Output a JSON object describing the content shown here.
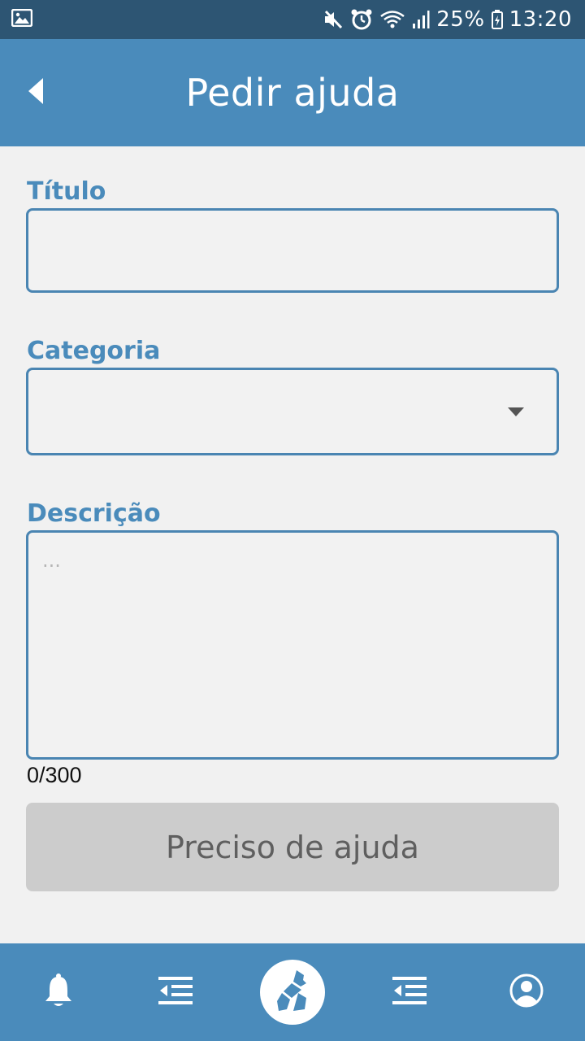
{
  "status_bar": {
    "battery": "25%",
    "time": "13:20",
    "icons": [
      "image-icon",
      "mute-icon",
      "alarm-icon",
      "wifi-icon",
      "signal-icon",
      "battery-icon"
    ]
  },
  "app_bar": {
    "title": "Pedir ajuda",
    "back_icon": "back-arrow-icon"
  },
  "form": {
    "titulo": {
      "label": "Título",
      "value": ""
    },
    "categoria": {
      "label": "Categoria",
      "selected": ""
    },
    "descricao": {
      "label": "Descrição",
      "placeholder": "...",
      "value": ""
    },
    "char_counter": "0/300",
    "submit_label": "Preciso de ajuda"
  },
  "bottom_nav": {
    "items": [
      "bell-icon",
      "list-icon",
      "help-hand-icon",
      "list-icon",
      "profile-icon"
    ]
  },
  "colors": {
    "primary": "#4a8bbb",
    "status_bar": "#2d5573",
    "background": "#f1f1f1",
    "button_disabled": "#cccccc"
  }
}
